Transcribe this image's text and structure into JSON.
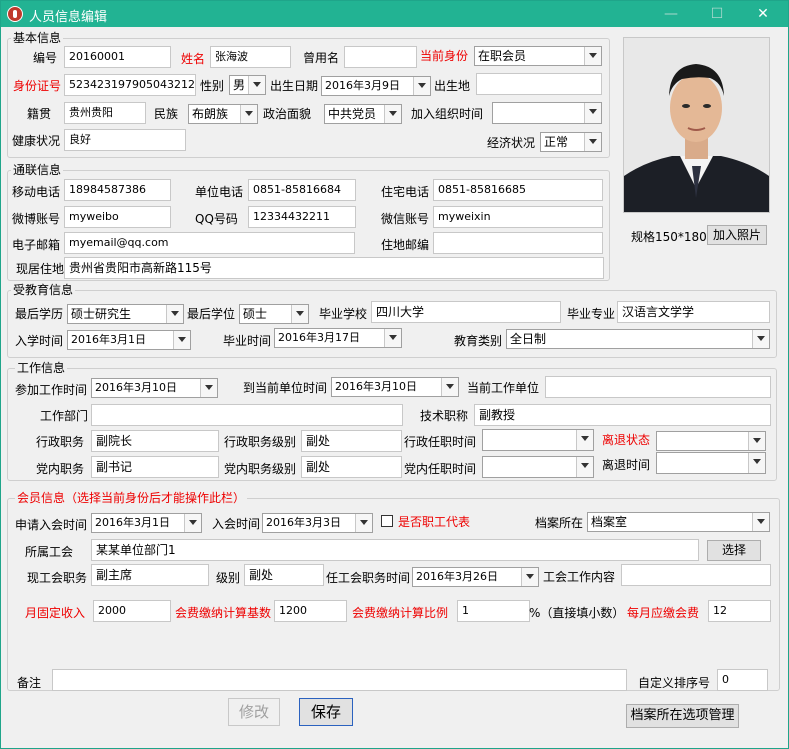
{
  "window": {
    "title": "人员信息编辑",
    "minimize": "—",
    "maximize": "☐",
    "close": "✕"
  },
  "basic": {
    "legend": "基本信息",
    "id_label": "编号",
    "id_value": "20160001",
    "name_label": "姓名",
    "name_value": "张海波",
    "alias_label": "曾用名",
    "alias_value": "",
    "status_label": "当前身份",
    "status_value": "在职会员",
    "idcard_label": "身份证号",
    "idcard_value": "523423197905043212",
    "gender_label": "性别",
    "gender_value": "男",
    "birthdate_label": "出生日期",
    "birthdate_value": "2016年3月9日",
    "birthplace_label": "出生地",
    "birthplace_value": "",
    "native_label": "籍贯",
    "native_value": "贵州贵阳",
    "ethnic_label": "民族",
    "ethnic_value": "布朗族",
    "political_label": "政治面貌",
    "political_value": "中共党员",
    "joinorg_label": "加入组织时间",
    "joinorg_value": "",
    "health_label": "健康状况",
    "health_value": "良好",
    "economic_label": "经济状况",
    "economic_value": "正常"
  },
  "photo": {
    "spec_label": "规格150*180",
    "add_button": "加入照片"
  },
  "contact": {
    "legend": "通联信息",
    "mobile_label": "移动电话",
    "mobile_value": "18984587386",
    "workphone_label": "单位电话",
    "workphone_value": "0851-85816684",
    "homephone_label": "住宅电话",
    "homephone_value": "0851-85816685",
    "weibo_label": "微博账号",
    "weibo_value": "myweibo",
    "qq_label": "QQ号码",
    "qq_value": "12334432211",
    "wechat_label": "微信账号",
    "wechat_value": "myweixin",
    "email_label": "电子邮箱",
    "email_value": "myemail@qq.com",
    "zip_label": "住地邮编",
    "zip_value": "",
    "address_label": "现居住地",
    "address_value": "贵州省贵阳市高新路115号"
  },
  "education": {
    "legend": "受教育信息",
    "edu_label": "最后学历",
    "edu_value": "硕士研究生",
    "degree_label": "最后学位",
    "degree_value": "硕士",
    "school_label": "毕业学校",
    "school_value": "四川大学",
    "major_label": "毕业专业",
    "major_value": "汉语言文学学",
    "enroll_label": "入学时间",
    "enroll_value": "2016年3月1日",
    "grad_label": "毕业时间",
    "grad_value": "2016年3月17日",
    "type_label": "教育类别",
    "type_value": "全日制"
  },
  "work": {
    "legend": "工作信息",
    "start_label": "参加工作时间",
    "start_value": "2016年3月10日",
    "unitstart_label": "到当前单位时间",
    "unitstart_value": "2016年3月10日",
    "unit_label": "当前工作单位",
    "unit_value": "",
    "dept_label": "工作部门",
    "dept_value": "",
    "title_label": "技术职称",
    "title_value": "副教授",
    "admin_label": "行政职务",
    "admin_value": "副院长",
    "adminlevel_label": "行政职务级别",
    "adminlevel_value": "副处",
    "admintime_label": "行政任职时间",
    "admintime_value": "",
    "retire_label": "离退状态",
    "retire_value": "",
    "party_label": "党内职务",
    "party_value": "副书记",
    "partylevel_label": "党内职务级别",
    "partylevel_value": "副处",
    "partytime_label": "党内任职时间",
    "partytime_value": "",
    "retiretime_label": "离退时间",
    "retiretime_value": ""
  },
  "member": {
    "legend": "会员信息（选择当前身份后才能操作此栏）",
    "apply_label": "申请入会时间",
    "apply_value": "2016年3月1日",
    "join_label": "入会时间",
    "join_value": "2016年3月3日",
    "rep_label": "是否职工代表",
    "archive_label": "档案所在",
    "archive_value": "档案室",
    "union_label": "所属工会",
    "union_value": "某某单位部门1",
    "select_button": "选择",
    "post_label": "现工会职务",
    "post_value": "副主席",
    "level_label": "级别",
    "level_value": "副处",
    "posttime_label": "任工会职务时间",
    "posttime_value": "2016年3月26日",
    "content_label": "工会工作内容",
    "content_value": "",
    "income_label": "月固定收入",
    "income_value": "2000",
    "base_label": "会费缴纳计算基数",
    "base_value": "1200",
    "ratio_label": "会费缴纳计算比例",
    "ratio_value": "1",
    "ratio_hint": "%（直接填小数）",
    "monthly_label": "每月应缴会费",
    "monthly_value": "12"
  },
  "footer": {
    "note_label": "备注",
    "note_value": "",
    "sort_label": "自定义排序号",
    "sort_value": "0",
    "modify_button": "修改",
    "save_button": "保存",
    "archive_button": "档案所在选项管理"
  },
  "colors": {
    "titlebar": "#22b393",
    "required_label": "#ee0000",
    "checkbox_label": "#1f3fbf"
  }
}
